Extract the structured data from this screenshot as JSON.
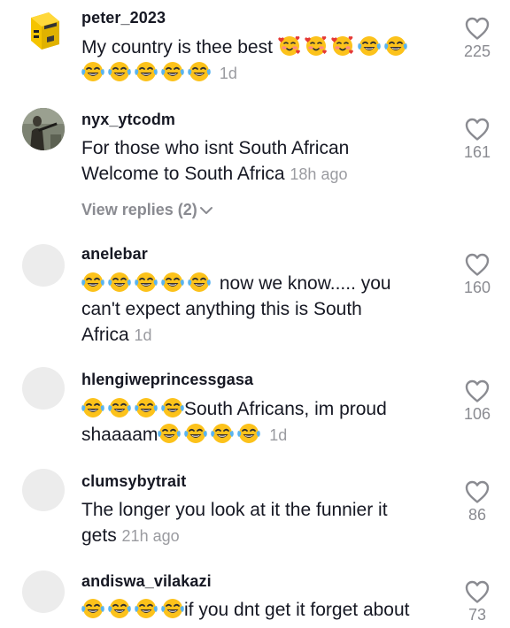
{
  "comments": [
    {
      "username": "peter_2023",
      "text_a": "My country is thee best",
      "text_b": "",
      "time": "1d",
      "likes": "225",
      "avatar": "yellow-box-logo"
    },
    {
      "username": "nyx_ytcodm",
      "text_a": "For those who isnt South African",
      "text_b": "Welcome to South Africa",
      "time": "18h ago",
      "likes": "161",
      "avatar": "soldier-photo",
      "view_replies": "View replies (2)"
    },
    {
      "username": "anelebar",
      "text_a": "now we know..... you",
      "text_b": "can't expect anything this is South",
      "text_c": "Africa",
      "time": "1d",
      "likes": "160",
      "avatar": "blank"
    },
    {
      "username": "hlengiweprincessgasa",
      "text_a": "South Africans, im proud",
      "text_b": "shaaaam",
      "time": "1d",
      "likes": "106",
      "avatar": "blank"
    },
    {
      "username": "clumsybytrait",
      "text_a": "The longer you look at it the funnier it",
      "text_b": "gets",
      "time": "21h ago",
      "likes": "86",
      "avatar": "blank"
    },
    {
      "username": "andiswa_vilakazi",
      "text_a": "if you dnt get it forget about",
      "likes": "73",
      "avatar": "blank"
    }
  ],
  "icons": {
    "like": "heart-outline-icon",
    "expand": "chevron-down-icon",
    "laugh": "face-with-tears-of-joy-emoji",
    "love": "smiling-face-with-hearts-emoji"
  },
  "colors": {
    "text": "#161823",
    "muted": "#8a8b91",
    "timestamp": "#9a9ba0"
  }
}
